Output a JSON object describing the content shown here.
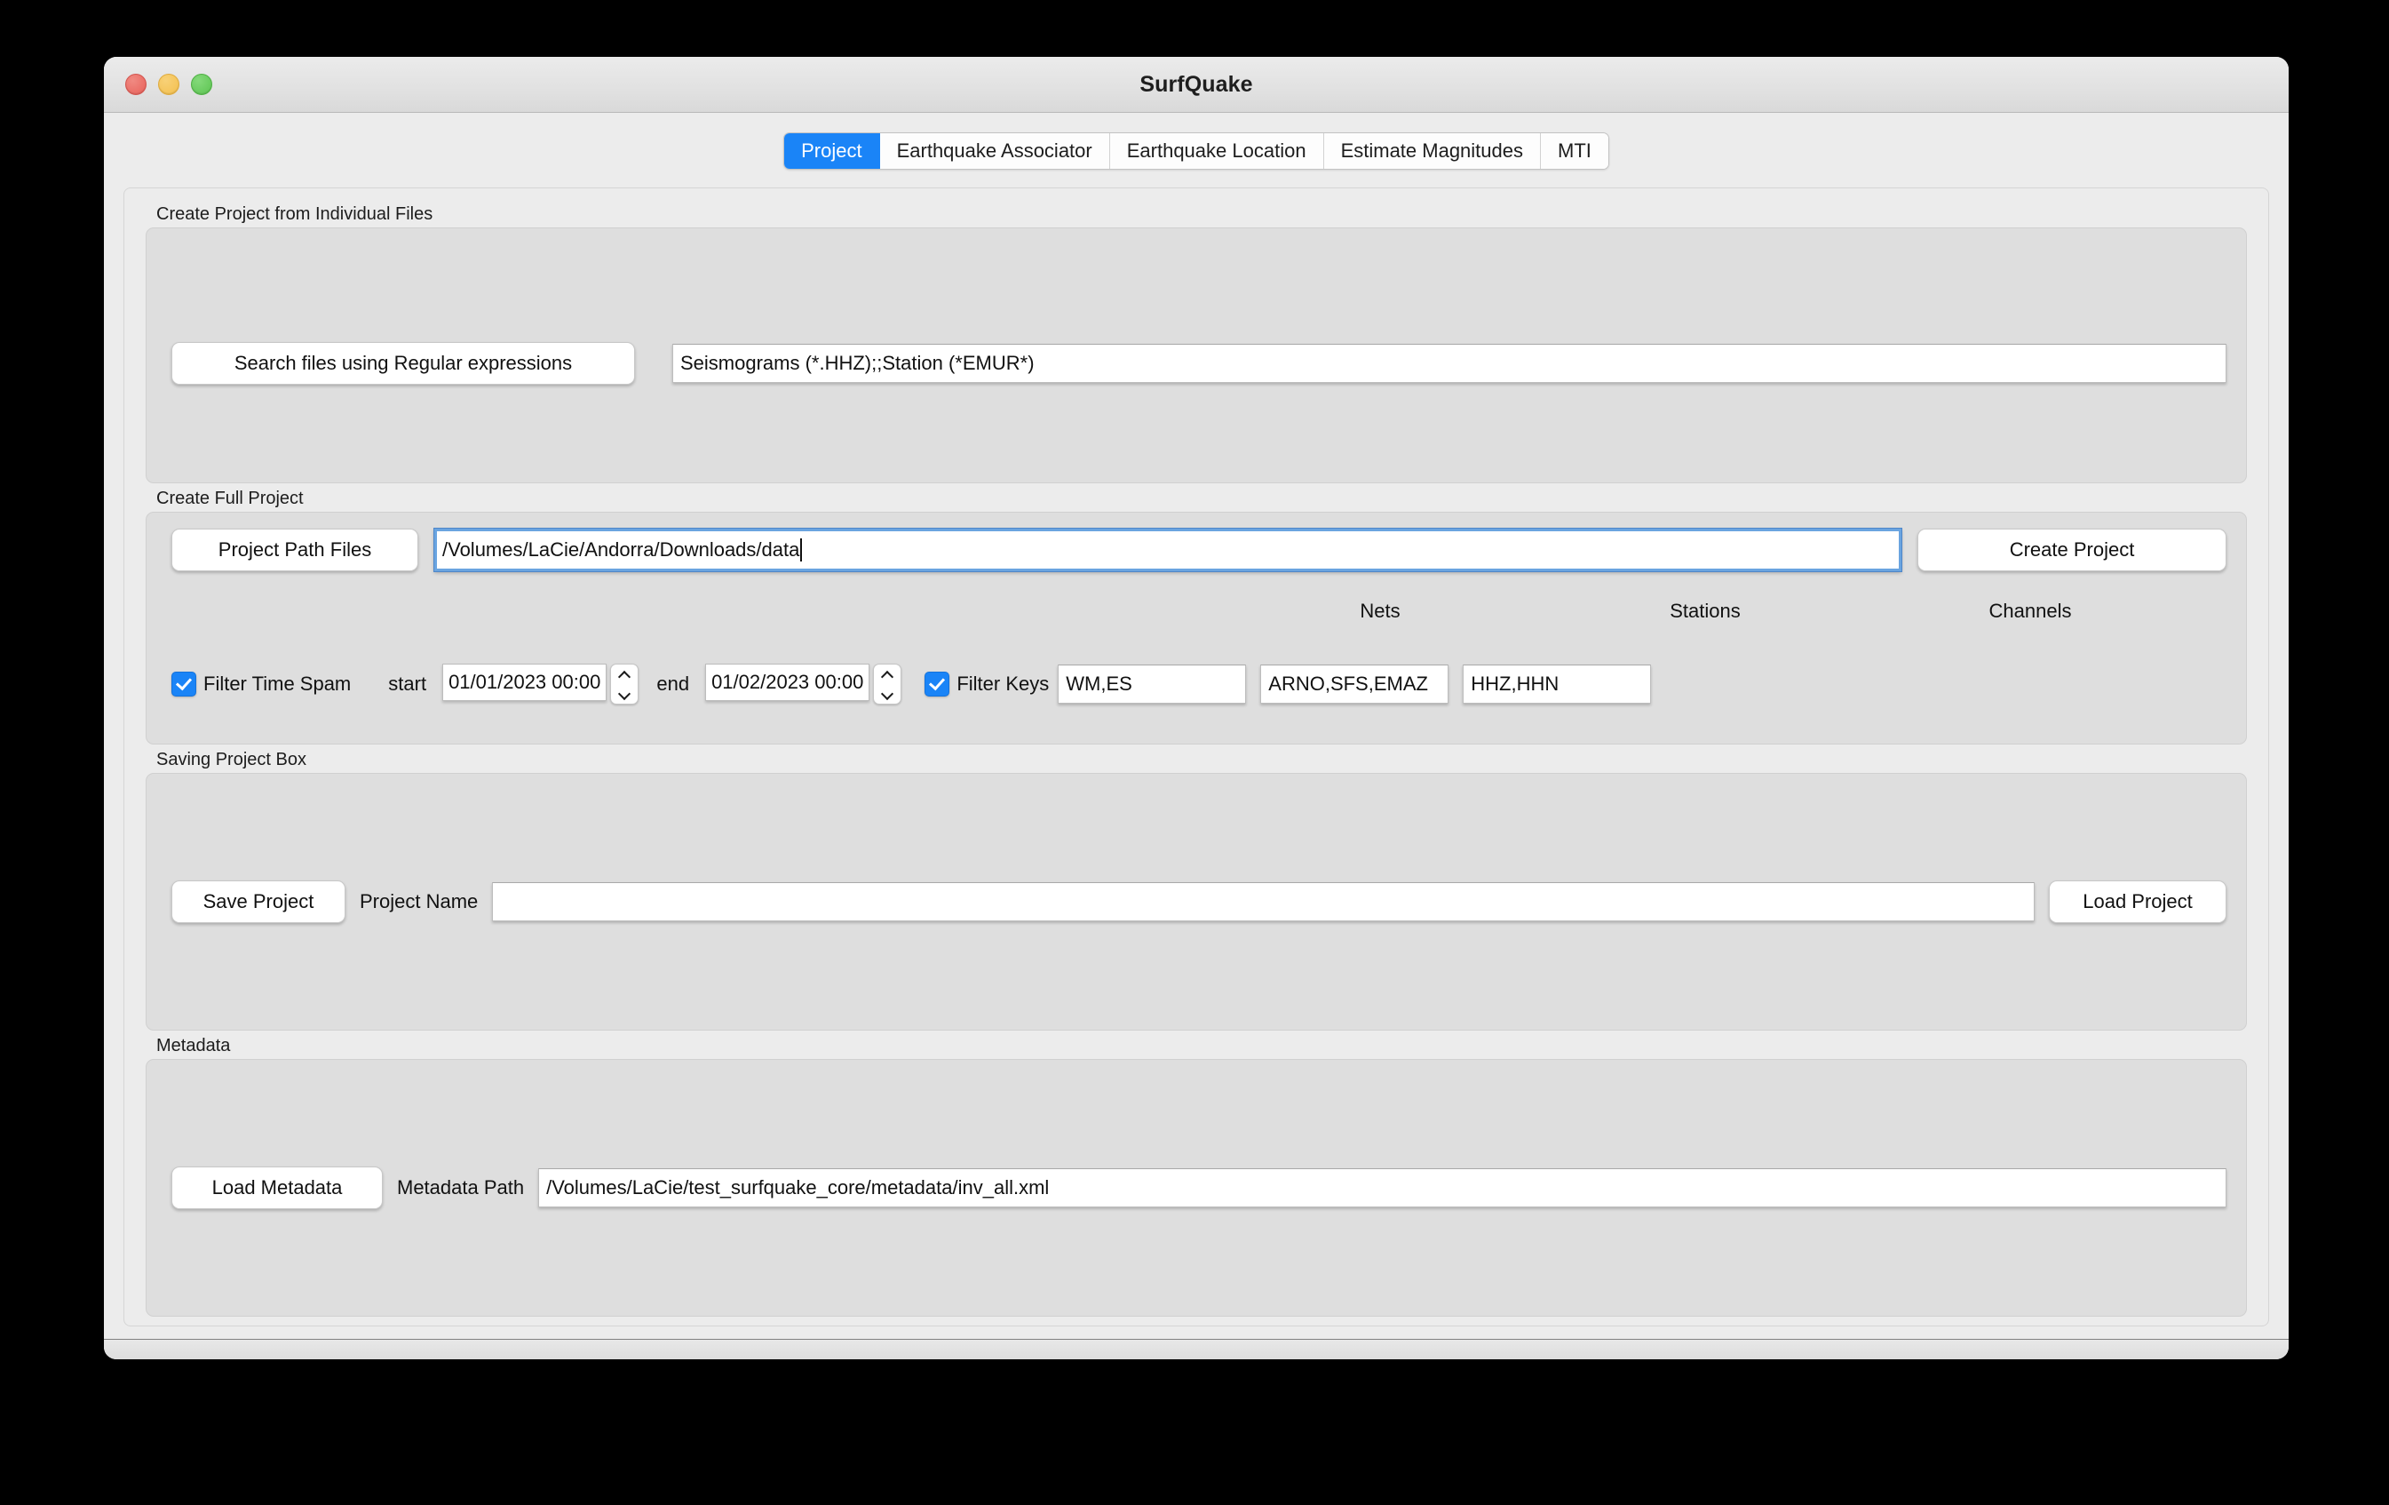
{
  "window": {
    "title": "SurfQuake",
    "traffic_lights": [
      {
        "name": "close",
        "color": "#e8615a"
      },
      {
        "name": "minimize",
        "color": "#f3bf4d"
      },
      {
        "name": "zoom",
        "color": "#5cc451"
      }
    ]
  },
  "tabs": [
    {
      "label": "Project",
      "active": true
    },
    {
      "label": "Earthquake Associator",
      "active": false
    },
    {
      "label": "Earthquake Location",
      "active": false
    },
    {
      "label": "Estimate Magnitudes",
      "active": false
    },
    {
      "label": "MTI",
      "active": false
    }
  ],
  "accent_color": "#1a84f7",
  "groups": {
    "individual": {
      "title": "Create Project from Individual Files",
      "search_button": "Search files using Regular expressions",
      "pattern_value": "Seismograms (*.HHZ);;Station (*EMUR*)",
      "pattern_placeholder": ""
    },
    "full_project": {
      "title": "Create Full Project",
      "path_button": "Project Path Files",
      "path_value": "/Volumes/LaCie/Andorra/Downloads/data",
      "path_placeholder": "",
      "create_button": "Create Project",
      "headers": {
        "nets": "Nets",
        "stations": "Stations",
        "channels": "Channels"
      },
      "filter_time": {
        "label": "Filter Time Spam",
        "checked": true,
        "start_label": "start",
        "start_value": "01/01/2023 00:00",
        "end_label": "end",
        "end_value": "01/02/2023 00:00"
      },
      "filter_keys": {
        "label": "Filter Keys",
        "checked": true,
        "nets_value": "WM,ES",
        "stations_value": "ARNO,SFS,EMAZ",
        "channels_value": "HHZ,HHN"
      }
    },
    "saving": {
      "title": "Saving Project Box",
      "save_button": "Save Project",
      "name_label": "Project Name",
      "name_value": "",
      "name_placeholder": "",
      "load_button": "Load Project"
    },
    "metadata": {
      "title": "Metadata",
      "load_button": "Load Metadata",
      "path_label": "Metadata Path",
      "path_value": "/Volumes/LaCie/test_surfquake_core/metadata/inv_all.xml",
      "path_placeholder": ""
    }
  }
}
